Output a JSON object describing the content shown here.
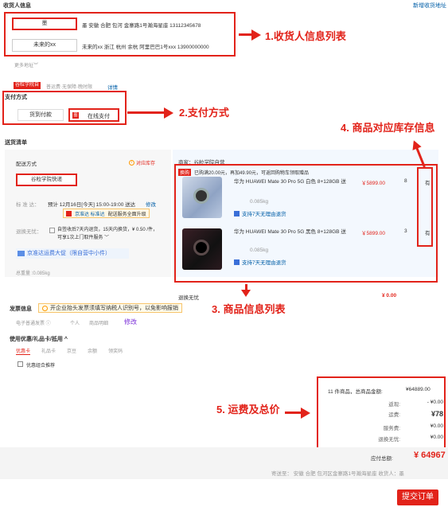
{
  "header": {
    "title": "收货人信息",
    "add_address": "新增收货地址"
  },
  "addresses": [
    {
      "name": "墨",
      "detail": "墨 安徽 合肥 包河 金寨路1号瀚海星座 13112345678"
    },
    {
      "name": "未来的xx",
      "detail": "未来的xx 浙江 杭州 余杭 阿里巴巴1号xxx 13900000000"
    }
  ],
  "more_address": "更多地址︾",
  "shop_tabs": {
    "active": "谷粒学院自",
    "other": "普运费·无保障·晚时限",
    "detail": "详情"
  },
  "payment": {
    "title": "支付方式",
    "cod": "货到付款",
    "online_icon": "图",
    "online": "在线支付"
  },
  "delivery": {
    "title": "送货清单",
    "method_label": "配送方式",
    "method_hint": "对应库存",
    "courier": "谷粒学院快递",
    "standard_label": "标 准 达：",
    "standard_text": "预计 12月16日[今天] 15:00-19:00 送达",
    "modify": "修改",
    "badge1": "京准达 标准达",
    "badge2": "配送服务全面升级",
    "return_label": "退换无忧：",
    "return_text": "自签收后7天内退货，15天内换货，¥ 0.50 /件，可享1次上门取件服务 ﹀",
    "promo": "京准达运费大促（限自营中小件）",
    "total_weight": "总重量 :0.085kg"
  },
  "goods": {
    "seller": "商家：谷粒学院自营",
    "promo_tag": "换购",
    "promo_text": "已购满20.00元，再加49.90元，可返回购物车领取赠品",
    "items": [
      {
        "name": "华为 HUAWEI Mate 30 Pro 5G 白色 8+128GB 送",
        "price": "￥5899.00",
        "qty": "8",
        "stock": "有",
        "weight": "0.085kg",
        "service": "支持7天无理由退货"
      },
      {
        "name": "华为 HUAWEI Mate 30 Pro 5G 黑色 8+128GB 送",
        "price": "￥5899.00",
        "qty": "3",
        "stock": "有",
        "weight": "0.085kg",
        "service": "支持7天无理由退货"
      }
    ],
    "return_free_label": "退换无忧",
    "return_free_price": "¥ 0.00"
  },
  "invoice": {
    "label": "发票信息",
    "notice": "开企业抬头发票须填写纳税人识别号，以免影响报销",
    "type1": "电子普通发票 ⓘ",
    "type2": "个人",
    "type3": "商品明细",
    "modify": "修改"
  },
  "coupon": {
    "title": "使用优惠/礼品卡/抵用 ^",
    "tabs": [
      "优惠卡",
      "礼品卡",
      "京豆",
      "余额",
      "领奖码"
    ],
    "combo": "优惠组合推荐"
  },
  "summary": {
    "count_text": "11 件商品，总商品金额:",
    "total_goods": "¥64889.00",
    "rows": [
      {
        "label": "返现:",
        "value": "- ¥0.00"
      },
      {
        "label": "运费:",
        "value": "¥78"
      },
      {
        "label": "服务费:",
        "value": "¥0.00"
      },
      {
        "label": "退换无忧:",
        "value": "¥0.00"
      }
    ],
    "pay_label": "应付总额:",
    "pay_value": "¥ 64967"
  },
  "footer": {
    "ship_to": "寄送至：  安徽 合肥 包河区金寨路1号瀚海星座  收货人：墨",
    "submit": "提交订单"
  },
  "annotations": {
    "a1": "1.收货人信息列表",
    "a2": "2.支付方式",
    "a3": "3. 商品信息列表",
    "a4": "4. 商品对应库存信息",
    "a5": "5. 运费及总价"
  },
  "colors": {
    "accent": "#e2231a",
    "link": "#005ea7",
    "panel": "#f3f8fe"
  }
}
